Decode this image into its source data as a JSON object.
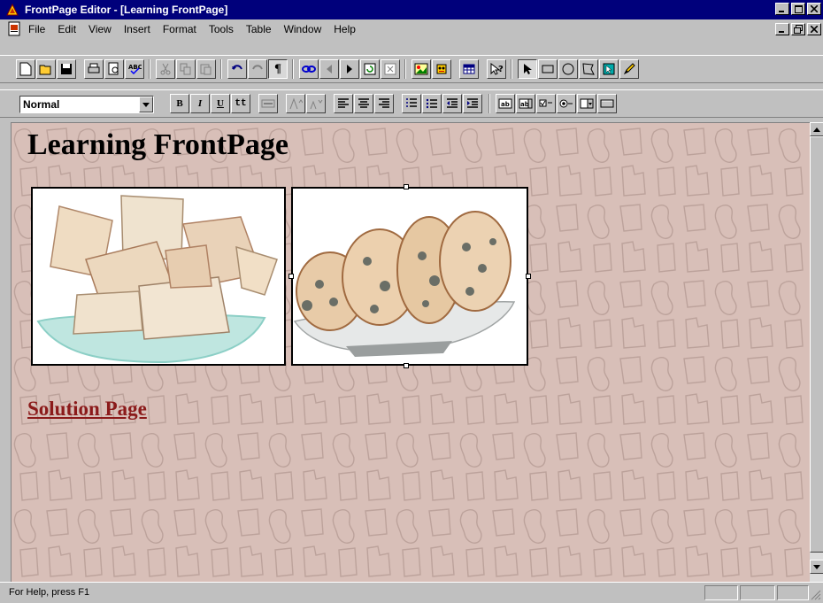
{
  "window": {
    "title": "FrontPage Editor - [Learning FrontPage]",
    "controls": [
      "minimize-icon",
      "maximize-icon",
      "close-icon"
    ]
  },
  "menu": {
    "items": [
      "File",
      "Edit",
      "View",
      "Insert",
      "Format",
      "Tools",
      "Table",
      "Window",
      "Help"
    ],
    "mdi_controls": [
      "minimize-icon",
      "restore-icon",
      "close-icon"
    ]
  },
  "toolbar_standard": {
    "buttons": [
      "new-page-icon",
      "open-icon",
      "save-icon",
      "print-icon",
      "print-preview-icon",
      "spelling-icon",
      "cut-icon",
      "copy-icon",
      "paste-icon",
      "undo-icon",
      "redo-icon",
      "paragraph-marks-icon",
      "hyperlink-icon",
      "back-icon",
      "forward-icon",
      "refresh-icon",
      "stop-icon",
      "image-icon",
      "webbot-icon",
      "table-icon",
      "help-pointer-icon",
      "select-icon",
      "rectangle-icon",
      "circle-icon",
      "polygon-icon",
      "hotspot-icon",
      "pencil-icon"
    ]
  },
  "toolbar_format": {
    "style_value": "Normal",
    "bold_label": "B",
    "italic_label": "I",
    "underline_label": "U",
    "typewriter_label": "tt",
    "buttons": [
      "text-color-icon",
      "increase-font-icon",
      "decrease-font-icon",
      "align-left-icon",
      "align-center-icon",
      "align-right-icon",
      "numbered-list-icon",
      "bulleted-list-icon",
      "decrease-indent-icon",
      "increase-indent-icon",
      "textbox-icon",
      "scrolling-text-icon",
      "checkbox-icon",
      "radio-button-icon",
      "dropdown-menu-icon",
      "push-button-icon"
    ]
  },
  "editor": {
    "heading": "Learning FrontPage",
    "images": [
      "crackers-drawing",
      "cookies-drawing"
    ],
    "link": "Solution Page"
  },
  "status": {
    "text": "For Help, press F1"
  },
  "colors": {
    "titlebar": "#00007b",
    "background": "#d8bfb8",
    "link": "#8b1a1a",
    "chrome": "#c0c0c0"
  }
}
